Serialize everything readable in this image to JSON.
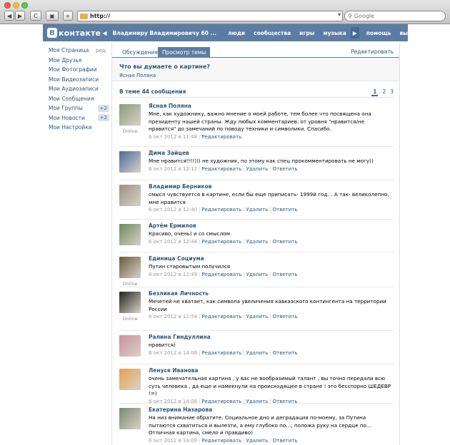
{
  "browser": {
    "url": "http://",
    "search_placeholder": "Google",
    "nav_back": "◀",
    "nav_forward": "▶",
    "reload": "C",
    "add": "+"
  },
  "header": {
    "logo_letter": "В",
    "logo_text": "контакте",
    "back_arrow": "◀",
    "breadcrumb": "Владимиру Владимировичу 60 ...",
    "nav": [
      "люди",
      "сообщества",
      "игры",
      "музыка"
    ],
    "more": "▶",
    "help": "помощь",
    "logout": "выйти"
  },
  "leftmenu": {
    "edit": "ред.",
    "items": [
      {
        "label": "Моя Страница",
        "badge": ""
      },
      {
        "label": "Мои Друзья",
        "badge": ""
      },
      {
        "label": "Мои Фотографии",
        "badge": ""
      },
      {
        "label": "Мои Видеозаписи",
        "badge": ""
      },
      {
        "label": "Мои Аудиозаписи",
        "badge": ""
      },
      {
        "label": "Мои Сообщения",
        "badge": ""
      },
      {
        "label": "Мои Группы",
        "badge": "+2"
      },
      {
        "label": "Мои Новости",
        "badge": "+2"
      },
      {
        "label": "Мои Настройки",
        "badge": ""
      }
    ]
  },
  "tabs": {
    "discussions": "Обсуждения",
    "view_topic": "Просмотр темы",
    "edit": "Редактировать"
  },
  "topic": {
    "title": "Что вы думаете о картине?",
    "subtitle": "Ясная Поляна",
    "count": "В теме 44 сообщения",
    "pages": [
      "1",
      "2",
      "3"
    ]
  },
  "actions": {
    "edit": "Редактировать",
    "delete": "Удалить",
    "reply": "Ответить",
    "online": "Online"
  },
  "posts": [
    {
      "author": "Ясная Поляна",
      "text": "Мне, как художнику, важно мнение о моей работе, тем более что посвящена она президенту нашей страны. Жду любых комментариев: от уровня \"нравится/не нравится\" до замечаний по поводу техники и символики. Спасибо.",
      "date": "6 окт 2012 в 11:48",
      "online": true,
      "own": true,
      "avatar": "#8a9a7a"
    },
    {
      "author": "Дима Зайцев",
      "text": "Мне нравится!!!!))) не художник, по этому как спец прокомментировать не могу))",
      "date": "6 окт 2012 в 12:11",
      "online": false,
      "own": false,
      "avatar": "#4a6b9a"
    },
    {
      "author": "Владимир Берников",
      "text": "смысл чувствуется в картине, если бы еще приписать- 1999й год… А так- великолепно, мне нравится",
      "date": "6 окт 2012 в 12:40",
      "online": false,
      "own": false,
      "avatar": "#9a8f85"
    },
    {
      "author": "Артём Ермилов",
      "text": "Красиво, очень) и со смыслом",
      "date": "6 окт 2012 в 12:44",
      "online": false,
      "own": false,
      "avatar": "#6e8a5a"
    },
    {
      "author": "Единица Социума",
      "text": "Путин старовытым получился",
      "date": "6 окт 2012 в 12:49",
      "online": true,
      "own": false,
      "avatar": "#6b5a3a"
    },
    {
      "author": "Безликая Личность",
      "text": "Мечетей не хватает, как символа увеличения кавказского контингента на территории России",
      "date": "6 окт 2012 в 12:54",
      "online": true,
      "own": false,
      "avatar": "#222222"
    },
    {
      "author": "Ралина Гиндуллина",
      "text": "нравится)",
      "date": "6 окт 2012 в 14:06",
      "online": false,
      "own": false,
      "avatar": "#c98fa0"
    },
    {
      "author": "Ленуся Иванова",
      "text": "очень замечательная картина , у вас не вообразимый талант , вы точно передали всю суть человека , да еще и намекнули на происходящее в стране ! это бесспорно ШЕДЕВР !=)",
      "date": "6 окт 2012 в 14:08",
      "online": false,
      "own": false,
      "avatar": "#e8a050"
    },
    {
      "author": "Екатерина Назарова",
      "text": "На низ внимание обратите. Социальное дно и деградация по-моему, за Путина пытаются схватиться и вылезти, а ему глубоко по…, положа руку на сердце по… Отличная картина, смело и правдиво)",
      "date": "6 окт 2012 в 14:09",
      "online": false,
      "own": false,
      "avatar": "#7a8a70"
    }
  ],
  "colors": {
    "vk_blue": "#5b7da4",
    "link": "#2b587a",
    "meta": "#999999"
  }
}
